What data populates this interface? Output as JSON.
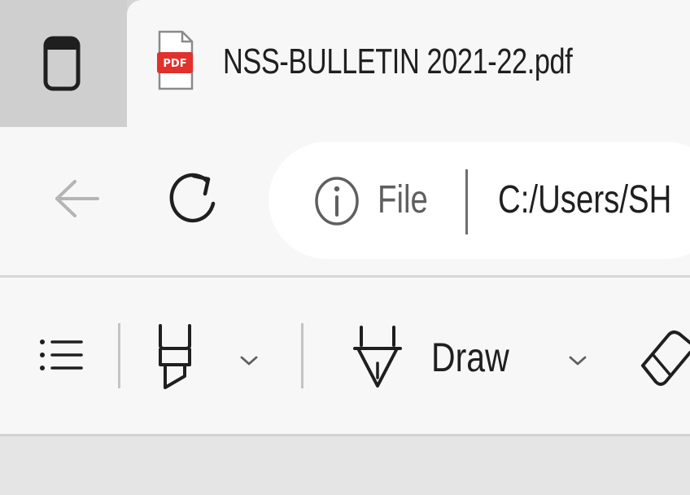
{
  "tab": {
    "title": "NSS-BULLETIN 2021-22.pdf",
    "file_icon_label": "PDF",
    "file_icon": "pdf-file-icon",
    "tab_actions_icon": "tab-actions-icon"
  },
  "navigation": {
    "back_icon": "back-arrow-icon",
    "refresh_icon": "refresh-icon",
    "address": {
      "info_icon": "info-icon",
      "scheme_label": "File",
      "url": "C:/Users/SH"
    }
  },
  "pdf_toolbar": {
    "contents_icon": "table-of-contents-icon",
    "highlight_icon": "highlighter-icon",
    "highlight_dropdown_icon": "chevron-down-icon",
    "draw_icon": "pen-icon",
    "draw_label": "Draw",
    "draw_dropdown_icon": "chevron-down-icon",
    "erase_icon": "eraser-icon"
  },
  "colors": {
    "tabstrip_bg": "#d4d4d4",
    "active_tab_bg": "#f7f7f7",
    "omnibox_bg": "#ffffff",
    "pdf_badge": "#e0312d",
    "content_bg": "#e5e5e5"
  }
}
